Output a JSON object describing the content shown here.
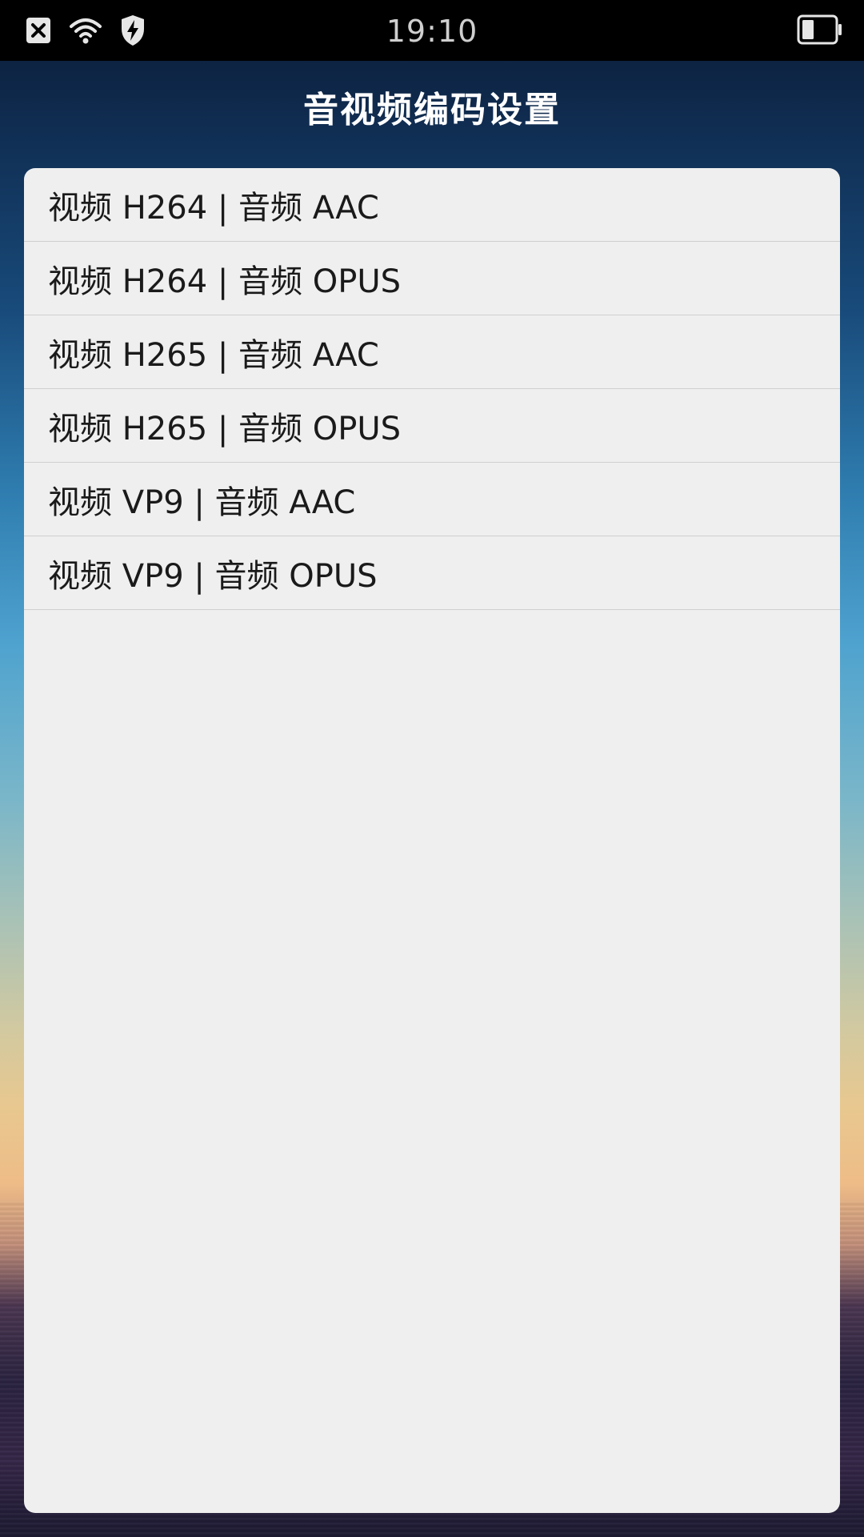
{
  "status_bar": {
    "time": "19:10",
    "icons": [
      "close-notification-icon",
      "wifi-icon",
      "shield-bolt-icon",
      "battery-icon"
    ]
  },
  "header": {
    "title": "音视频编码设置"
  },
  "codec_list": {
    "items": [
      {
        "label": "视频 H264 | 音频 AAC"
      },
      {
        "label": "视频 H264 | 音频 OPUS"
      },
      {
        "label": "视频 H265 | 音频 AAC"
      },
      {
        "label": "视频 H265 | 音频 OPUS"
      },
      {
        "label": "视频 VP9 | 音频 AAC"
      },
      {
        "label": "视频 VP9 | 音频 OPUS"
      }
    ]
  },
  "colors": {
    "status_bar_bg": "#000000",
    "panel_bg": "#efefef",
    "divider": "#cfcfcf",
    "title_text": "#ffffff",
    "item_text": "#1a1a1a"
  }
}
